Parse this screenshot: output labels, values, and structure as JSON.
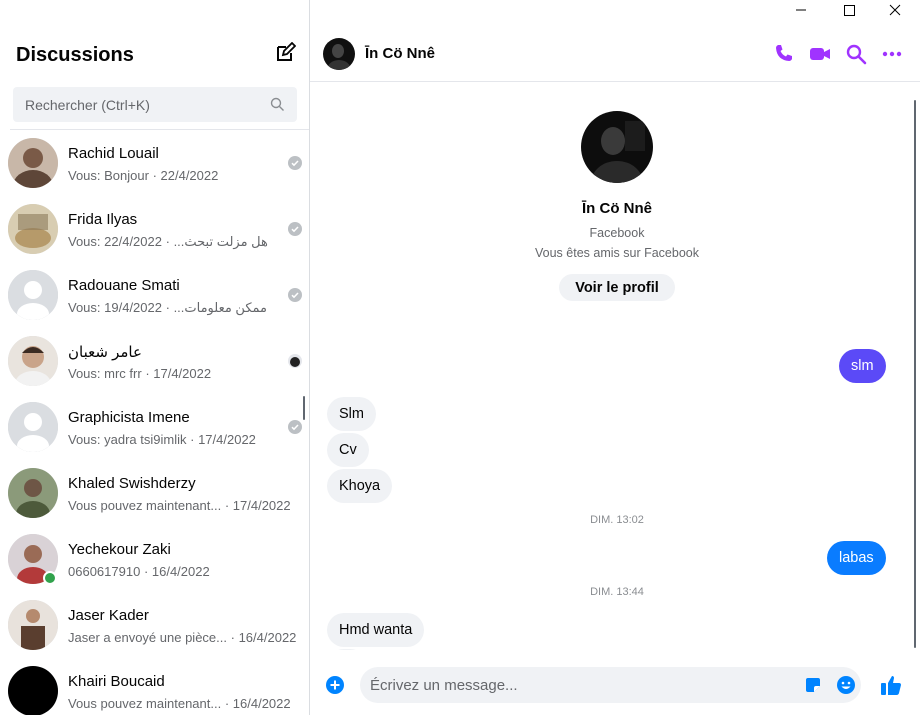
{
  "window": {
    "minimize": "—",
    "maximize": "☐",
    "close": "✕"
  },
  "sidebar": {
    "title": "Discussions",
    "search_placeholder": "Rechercher (Ctrl+K)",
    "conversations": [
      {
        "name": "Rachid Louail",
        "preview": "Vous: Bonjour",
        "date": "· 22/4/2022",
        "status": "seen-check",
        "avatar_color": "#7a5a47"
      },
      {
        "name": "Frida Ilyas",
        "preview": "Vous: هل مزلت تبحث...",
        "date": "· 22/4/2022",
        "status": "seen-check",
        "avatar_color": "#b69a6a"
      },
      {
        "name": "Radouane Smati",
        "preview": "Vous: ممكن معلومات...",
        "date": "· 19/4/2022",
        "status": "seen-check",
        "avatar_color": "default"
      },
      {
        "name": "عامر شعبان",
        "preview": "Vous: mrc frr",
        "date": "· 17/4/2022",
        "status": "seen-avatar",
        "avatar_color": "#c9a48a"
      },
      {
        "name": "Graphicista Imene",
        "preview": "Vous: yadra tsi9imlik",
        "date": "· 17/4/2022",
        "status": "seen-check",
        "avatar_color": "default"
      },
      {
        "name": "Khaled Swishderzy",
        "preview": "Vous pouvez maintenant...",
        "date": "· 17/4/2022",
        "status": "none",
        "avatar_color": "#4d5a3b"
      },
      {
        "name": "Yechekour Zaki",
        "preview": "0660617910",
        "date": "· 16/4/2022",
        "status": "online",
        "avatar_color": "#9a6b56"
      },
      {
        "name": "Jaser Kader",
        "preview": "Jaser a envoyé une pièce...",
        "date": "· 16/4/2022",
        "status": "none",
        "avatar_color": "#5a3e2f"
      },
      {
        "name": "Khairi Boucaid",
        "preview": "Vous pouvez maintenant...",
        "date": "· 16/4/2022",
        "status": "none",
        "avatar_color": "#000000"
      }
    ]
  },
  "chat": {
    "name": "Īn Cö Nnê",
    "profile": {
      "name": "Īn Cö Nnê",
      "source": "Facebook",
      "relation": "Vous êtes amis sur Facebook",
      "button": "Voir le profil"
    },
    "messages": [
      {
        "dir": "out2",
        "text": "slm"
      },
      {
        "dir": "in",
        "text": "Slm"
      },
      {
        "dir": "in",
        "text": "Cv"
      },
      {
        "dir": "in",
        "text": "Khoya"
      },
      {
        "dir": "time",
        "text": "DIM. 13:02"
      },
      {
        "dir": "out",
        "text": "labas"
      },
      {
        "dir": "time",
        "text": "DIM. 13:44"
      },
      {
        "dir": "in",
        "text": "Hmd wanta"
      }
    ],
    "composer_placeholder": "Écrivez un message..."
  },
  "colors": {
    "accent": "#a033ff",
    "out_bubble": "#0a7cff",
    "out_bubble_alt": "#5b4af7",
    "messenger_blue": "#0084ff"
  }
}
